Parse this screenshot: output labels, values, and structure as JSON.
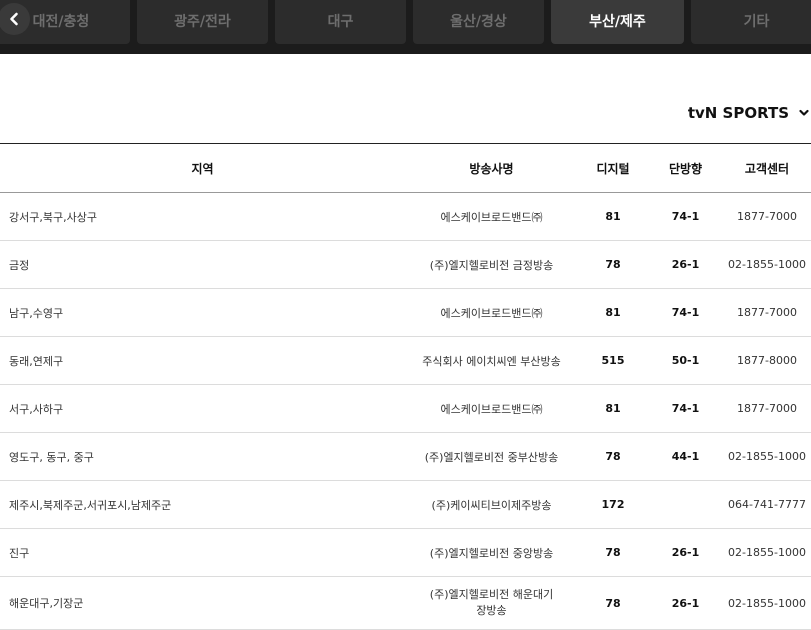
{
  "tabs": [
    {
      "label": "대전/충청",
      "active": false
    },
    {
      "label": "광주/전라",
      "active": false
    },
    {
      "label": "대구",
      "active": false
    },
    {
      "label": "울산/경상",
      "active": false
    },
    {
      "label": "부산/제주",
      "active": true
    },
    {
      "label": "기타",
      "active": false
    }
  ],
  "channel": {
    "name": "tvN SPORTS"
  },
  "table": {
    "headers": [
      "지역",
      "방송사명",
      "디지털",
      "단방향",
      "고객센터"
    ],
    "rows": [
      [
        "강서구,북구,사상구",
        "에스케이브로드밴드㈜",
        "81",
        "74-1",
        "1877-7000"
      ],
      [
        "금정",
        "(주)엘지헬로비전 금정방송",
        "78",
        "26-1",
        "02-1855-1000"
      ],
      [
        "남구,수영구",
        "에스케이브로드밴드㈜",
        "81",
        "74-1",
        "1877-7000"
      ],
      [
        "동래,연제구",
        "주식회사 에이치씨엔 부산방송",
        "515",
        "50-1",
        "1877-8000"
      ],
      [
        "서구,사하구",
        "에스케이브로드밴드㈜",
        "81",
        "74-1",
        "1877-7000"
      ],
      [
        "영도구, 동구, 중구",
        "(주)엘지헬로비전 중부산방송",
        "78",
        "44-1",
        "02-1855-1000"
      ],
      [
        "제주시,북제주군,서귀포시,남제주군",
        "(주)케이씨티브이제주방송",
        "172",
        "",
        "064-741-7777"
      ],
      [
        "진구",
        "(주)엘지헬로비전 중앙방송",
        "78",
        "26-1",
        "02-1855-1000"
      ],
      [
        "해운대구,기장군",
        "(주)엘지헬로비전 해운대기장방송",
        "78",
        "26-1",
        "02-1855-1000"
      ]
    ]
  },
  "colors": {
    "topbar": "#1c1c1c",
    "tab": "#2c2c2c",
    "tab_active": "#3a3a3a"
  },
  "icons": {
    "back": "chevron-left-icon",
    "dropdown": "chevron-down-icon"
  }
}
